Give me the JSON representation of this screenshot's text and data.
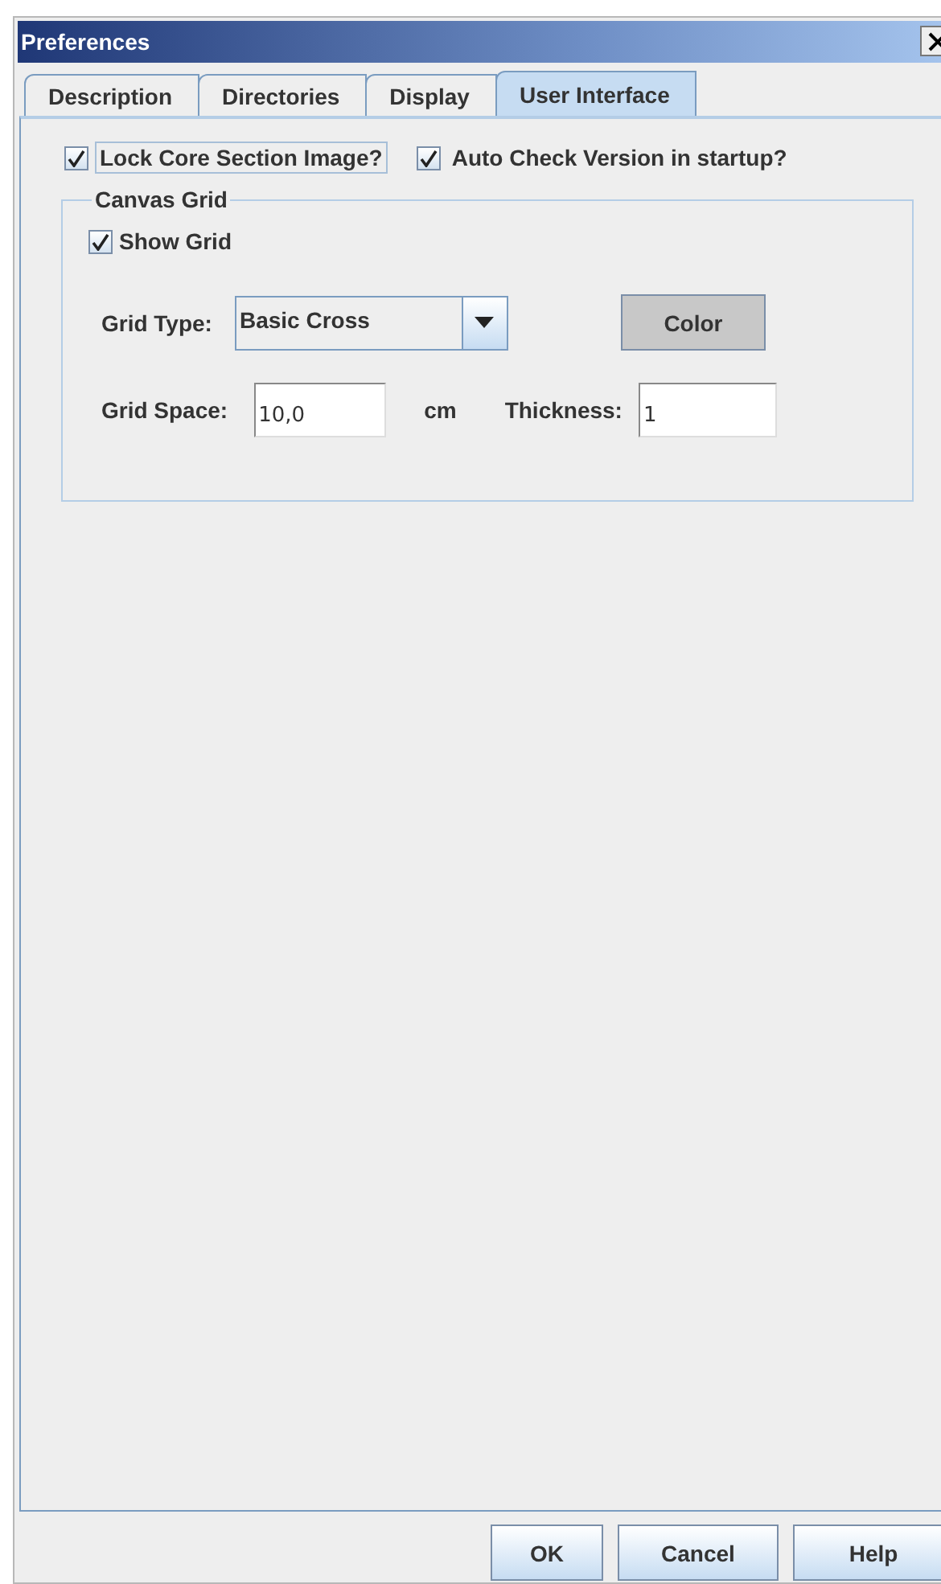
{
  "window": {
    "title": "Preferences"
  },
  "tabs": [
    {
      "label": "Description",
      "selected": false
    },
    {
      "label": "Directories",
      "selected": false
    },
    {
      "label": "Display",
      "selected": false
    },
    {
      "label": "User Interface",
      "selected": true
    }
  ],
  "options": [
    {
      "label": "Lock Core Section Image?",
      "checked": true,
      "focused": true
    },
    {
      "label": "Auto Check Version in startup?",
      "checked": true,
      "focused": false
    }
  ],
  "canvas_grid": {
    "title": "Canvas Grid",
    "show_grid": {
      "label": "Show Grid",
      "checked": true
    },
    "grid_type": {
      "label": "Grid Type:",
      "value": "Basic Cross"
    },
    "color_button": "Color",
    "grid_space": {
      "label": "Grid Space:",
      "value": "10,0",
      "unit": "cm"
    },
    "thickness": {
      "label": "Thickness:",
      "value": "1"
    }
  },
  "buttons": [
    "OK",
    "Cancel",
    "Help"
  ]
}
